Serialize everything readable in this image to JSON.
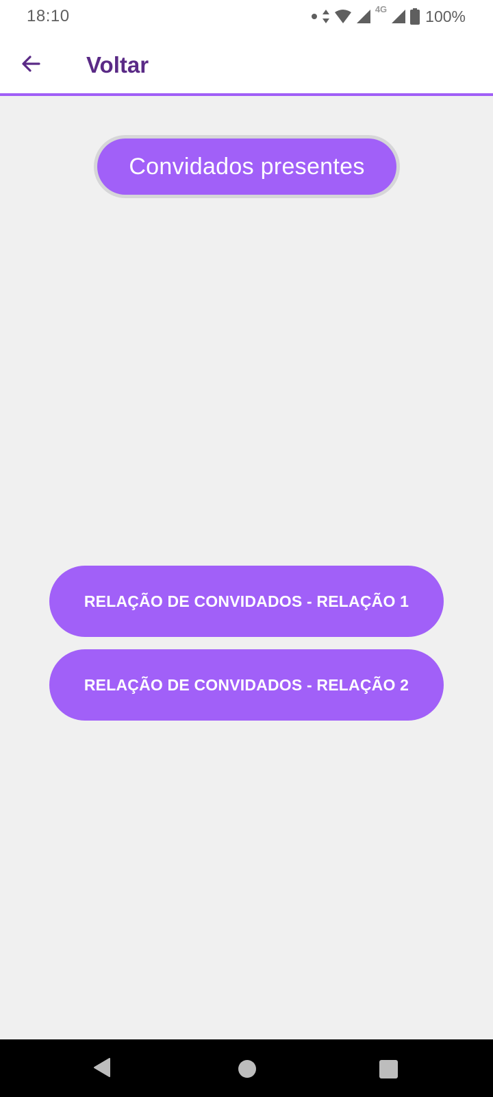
{
  "status_bar": {
    "time": "18:10",
    "network": "4G",
    "battery": "100%"
  },
  "app_bar": {
    "title": "Voltar",
    "back_icon": "arrow-left-icon"
  },
  "main": {
    "heading": "Convidados presentes",
    "buttons": [
      {
        "label": "RELAÇÃO DE CONVIDADOS - RELAÇÃO 1"
      },
      {
        "label": "RELAÇÃO DE CONVIDADOS - RELAÇÃO 2"
      }
    ]
  },
  "nav_bar": {
    "icons": [
      "nav-back-icon",
      "nav-home-icon",
      "nav-recents-icon"
    ]
  },
  "colors": {
    "accent": "#a160f8",
    "title_text": "#5a2a86",
    "background": "#f0f0f0"
  }
}
